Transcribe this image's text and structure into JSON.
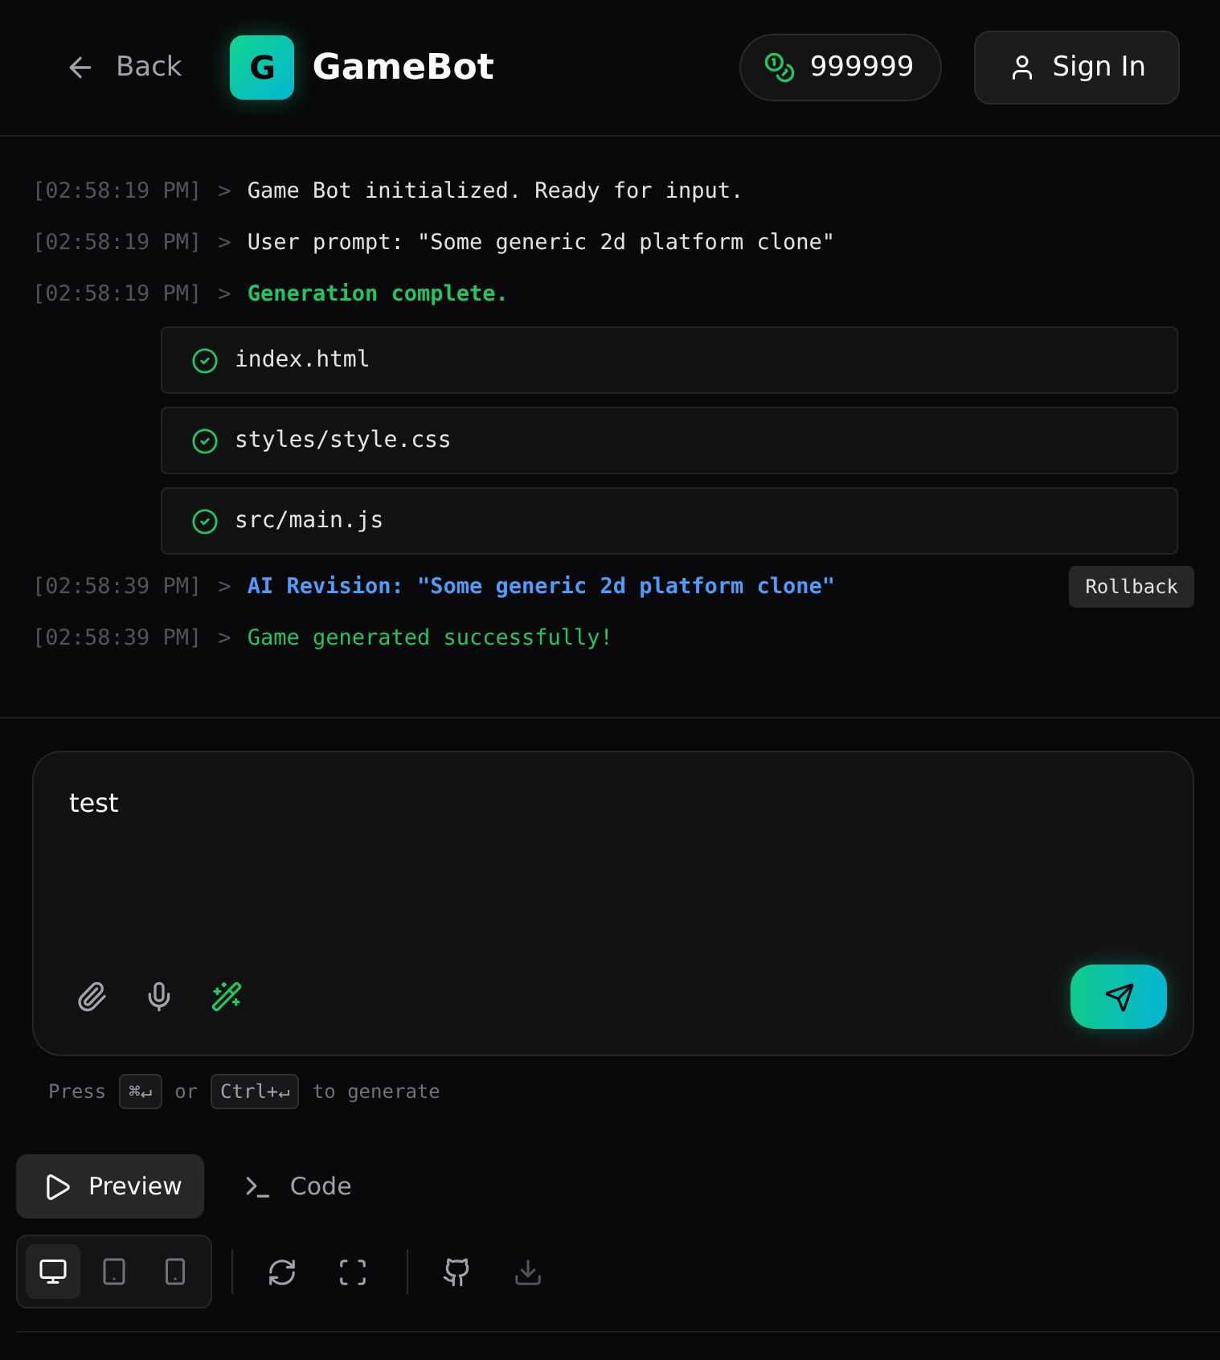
{
  "header": {
    "back": "Back",
    "logo_letter": "G",
    "brand": "GameBot",
    "credits": "999999",
    "sign_in": "Sign In"
  },
  "log": [
    {
      "kind": "plain",
      "time": "[02:58:19 PM]",
      "prompt": ">",
      "text": "Game Bot initialized. Ready for input."
    },
    {
      "kind": "plain",
      "time": "[02:58:19 PM]",
      "prompt": ">",
      "text": "User prompt: \"Some generic 2d platform clone\""
    },
    {
      "kind": "success_bold",
      "time": "[02:58:19 PM]",
      "prompt": ">",
      "text": "Generation complete."
    },
    {
      "kind": "files",
      "files": [
        "index.html",
        "styles/style.css",
        "src/main.js"
      ]
    },
    {
      "kind": "revision",
      "time": "[02:58:39 PM]",
      "prompt": ">",
      "text": "AI Revision: \"Some generic 2d platform clone\"",
      "action": "Rollback"
    },
    {
      "kind": "success",
      "time": "[02:58:39 PM]",
      "prompt": ">",
      "text": "Game generated successfully!"
    }
  ],
  "composer": {
    "value": "test"
  },
  "hint": {
    "press": "Press",
    "key1": "⌘↵",
    "or": "or",
    "key2": "Ctrl+↵",
    "suffix": "to generate"
  },
  "view_tabs": [
    {
      "kind": "preview",
      "label": "Preview",
      "selected": true
    },
    {
      "kind": "code",
      "label": "Code",
      "selected": false
    }
  ],
  "devices": [
    {
      "kind": "desktop",
      "selected": true
    },
    {
      "kind": "tablet",
      "selected": false
    },
    {
      "kind": "phone",
      "selected": false
    }
  ],
  "tools": [
    {
      "kind": "refresh",
      "disabled": false
    },
    {
      "kind": "fullscreen",
      "disabled": false
    },
    {
      "kind": "sep"
    },
    {
      "kind": "github",
      "disabled": false
    },
    {
      "kind": "download",
      "disabled": true
    }
  ]
}
